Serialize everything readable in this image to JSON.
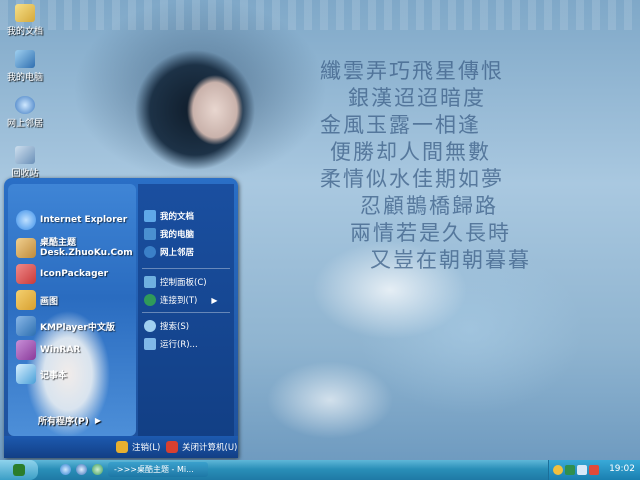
{
  "desktop": {
    "icons": [
      {
        "label": "我的文档",
        "icon": "folder-documents-icon"
      },
      {
        "label": "我的电脑",
        "icon": "computer-icon"
      },
      {
        "label": "网上邻居",
        "icon": "network-icon"
      },
      {
        "label": "回收站",
        "icon": "recycle-bin-icon"
      }
    ],
    "poem": [
      "纖雲弄巧飛星傳恨",
      "銀漢迢迢暗度",
      "金風玉露一相逢",
      "便勝却人間無數",
      "柔情似水佳期如夢",
      "忍顧鵲橋歸路",
      "兩情若是久長時",
      "又豈在朝朝暮暮"
    ]
  },
  "start_menu": {
    "programs": [
      {
        "label": "Internet Explorer",
        "icon": "internet-explorer-icon",
        "color": "#3a8ee8"
      },
      {
        "label": "桌酷主题",
        "sublabel": "Desk.ZhuoKu.Com",
        "icon": "zhuoku-theme-icon",
        "color": "#c08a3a"
      },
      {
        "label": "IconPackager",
        "icon": "iconpackager-icon",
        "color": "#c83a3a"
      },
      {
        "label": "画图",
        "icon": "paint-icon",
        "color": "#d8a030"
      },
      {
        "label": "KMPlayer中文版",
        "icon": "kmplayer-icon",
        "color": "#2d6fb0"
      },
      {
        "label": "WinRAR",
        "icon": "winrar-icon",
        "color": "#8a3a9a"
      },
      {
        "label": "记事本",
        "icon": "notepad-icon",
        "color": "#4aa0d8"
      }
    ],
    "all_programs": "所有程序(P)",
    "places": [
      {
        "label": "我的文档",
        "icon": "my-documents-icon",
        "bold": true
      },
      {
        "label": "我的电脑",
        "icon": "my-computer-icon",
        "bold": true
      },
      {
        "label": "网上邻居",
        "icon": "network-places-icon",
        "bold": true
      },
      {
        "label": "控制面板(C)",
        "icon": "control-panel-icon",
        "bold": false
      },
      {
        "label": "连接到(T)",
        "icon": "connect-to-icon",
        "bold": false,
        "submenu": true
      },
      {
        "label": "搜索(S)",
        "icon": "search-icon",
        "bold": false
      },
      {
        "label": "运行(R)...",
        "icon": "run-icon",
        "bold": false
      }
    ],
    "logoff": "注销(L)",
    "shutdown": "关闭计算机(U)"
  },
  "taskbar": {
    "task_label": "->>>桌酷主题 - Mi...",
    "clock": "19:02"
  }
}
